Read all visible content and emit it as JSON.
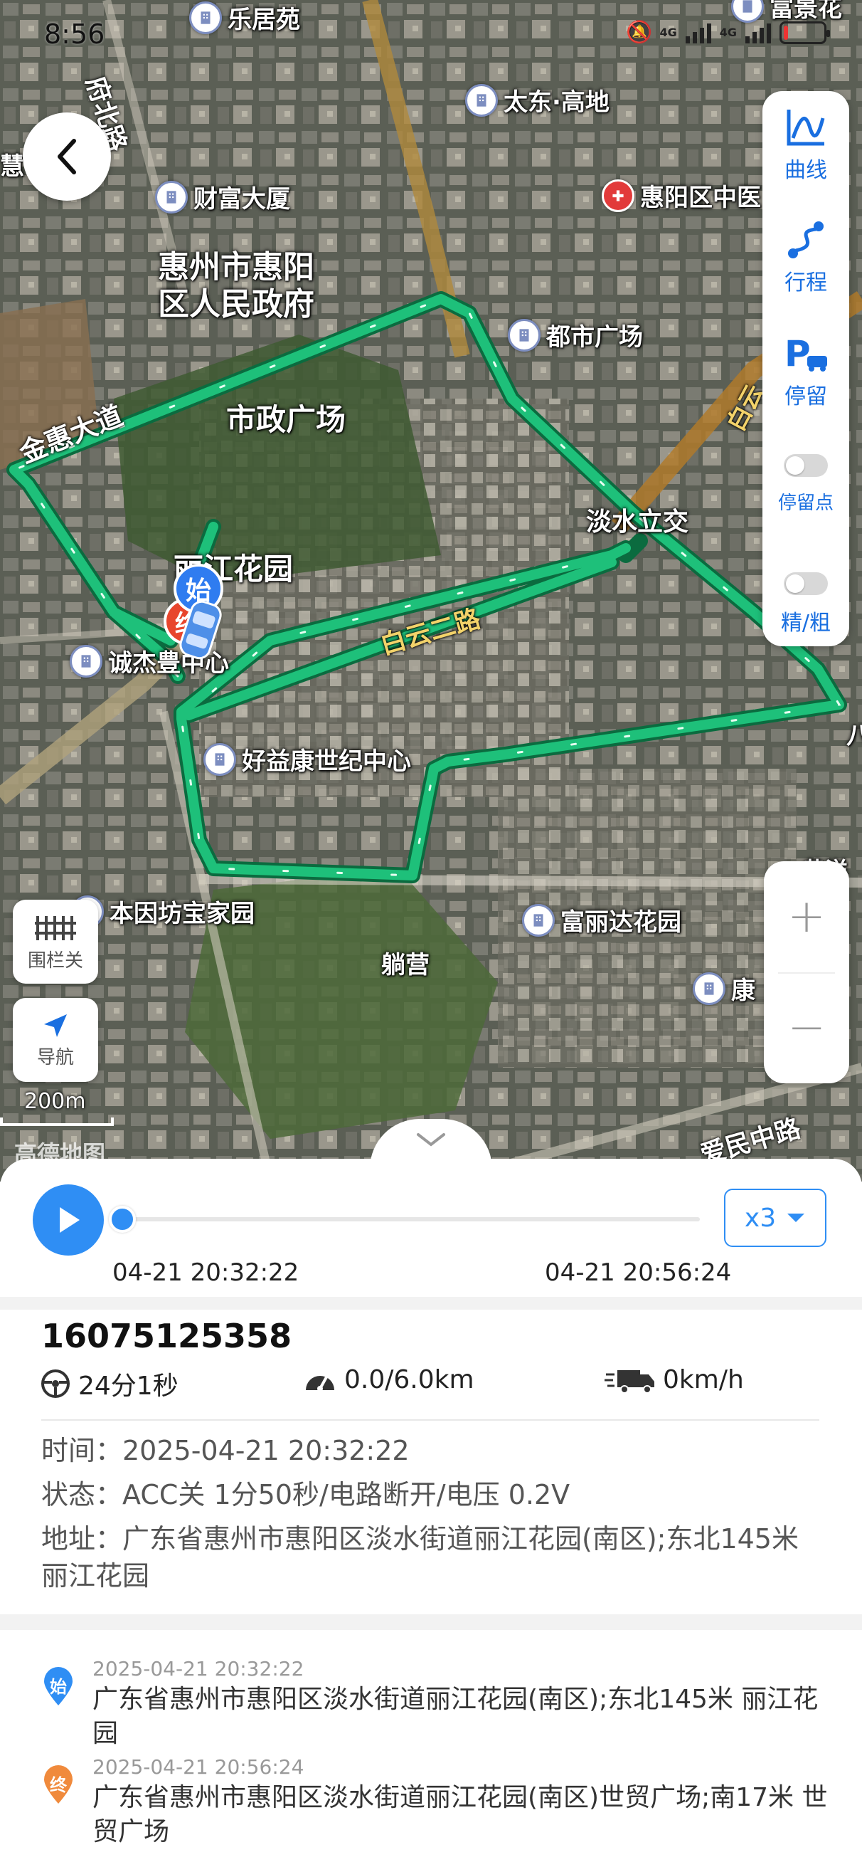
{
  "status_bar": {
    "time": "8:56",
    "network": "4G",
    "network2": "4G"
  },
  "map": {
    "area_labels": [
      "惠州市惠阳",
      "区人民政府",
      "市政广场",
      "丽江花园",
      "淡水立交",
      "躺营"
    ],
    "road_labels": [
      "府北路",
      "金惠大道",
      "白云二路",
      "爱民中路",
      "白云"
    ],
    "pois": [
      "乐居苑",
      "太东·高地",
      "财富大厦",
      "惠阳区中医",
      "都市广场",
      "诚杰豊中心",
      "好益康世纪中心",
      "本因坊宝家园",
      "富丽达花园",
      "康",
      "富景花"
    ],
    "edge_labels": [
      "慧",
      "八",
      "黄洋"
    ],
    "start_marker": "始",
    "end_marker": "终",
    "route_color": "#1ec07a",
    "scale_label": "200m",
    "logo_text": "高德地图"
  },
  "right_panel": {
    "curve": "曲线",
    "trip": "行程",
    "stay": "停留",
    "stay_point": "停留点",
    "precision": "精/粗"
  },
  "left_buttons": {
    "fence": "围栏关",
    "navigate": "导航"
  },
  "zoom": {
    "in": "+",
    "out": "−"
  },
  "playback": {
    "speed": "x3",
    "start_time": "04-21 20:32:22",
    "end_time": "04-21 20:56:24",
    "progress": 0,
    "accent": "#2f8ef4"
  },
  "device": {
    "plate": "16075125358",
    "duration": "24分1秒",
    "distance": "0.0/6.0km",
    "speed": "0km/h"
  },
  "details": {
    "time": "时间：2025-04-21 20:32:22",
    "status": "状态：ACC关 1分50秒/电路断开/电压 0.2V",
    "address": "地址：广东省惠州市惠阳区淡水街道丽江花园(南区);东北145米 丽江花园"
  },
  "records": [
    {
      "badge": "始",
      "time": "2025-04-21 20:32:22",
      "address": "广东省惠州市惠阳区淡水街道丽江花园(南区);东北145米 丽江花园",
      "color": "#2f8ef4"
    },
    {
      "badge": "终",
      "time": "2025-04-21 20:56:24",
      "address": "广东省惠州市惠阳区淡水街道丽江花园(南区)世贸广场;南17米 世贸广场",
      "color": "#f08a3c"
    }
  ]
}
